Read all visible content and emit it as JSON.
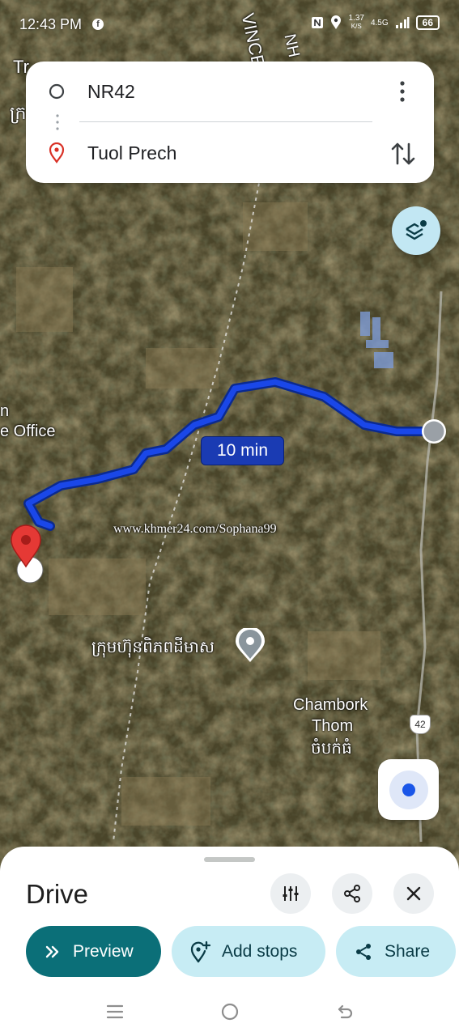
{
  "status_bar": {
    "time": "12:43 PM",
    "network_speed_value": "1.37",
    "network_speed_unit": "K/S",
    "network_type": "4.5G",
    "battery": "66",
    "icons": [
      "facebook-icon",
      "nfc-icon",
      "location-icon",
      "signal-icon",
      "battery-icon"
    ]
  },
  "directions": {
    "origin": "NR42",
    "destination": "Tuol Prech",
    "icons": [
      "origin-circle-icon",
      "destination-pin-icon",
      "more-vert-icon",
      "swap-icon"
    ]
  },
  "map": {
    "route_duration": "10 min",
    "watermark": "www.khmer24.com/Sophana99",
    "labels": {
      "top_left_1": "Tr",
      "top_left_2": "ក្រ",
      "province_1": "VINCE",
      "province_2": "NH",
      "office_1": "n",
      "office_2": "e Office",
      "company": "ក្រុមហ៊ុនពិភពដីមាស",
      "town_en_1": "Chambork",
      "town_en_2": "Thom",
      "town_km": "ចំបក់ធំ",
      "road_shield": "42"
    },
    "route_color": "#1a47e8",
    "colors": {
      "accent": "#0b6f78",
      "pin": "#e53935"
    }
  },
  "bottom_sheet": {
    "title": "Drive",
    "buttons": {
      "preview": "Preview",
      "add_stops": "Add stops",
      "share": "Share"
    },
    "icons": [
      "tune-icon",
      "share-icon",
      "close-icon",
      "chevrons-icon",
      "add-location-icon"
    ]
  },
  "nav_bar": {
    "icons": [
      "recents-icon",
      "home-icon",
      "back-icon"
    ]
  }
}
